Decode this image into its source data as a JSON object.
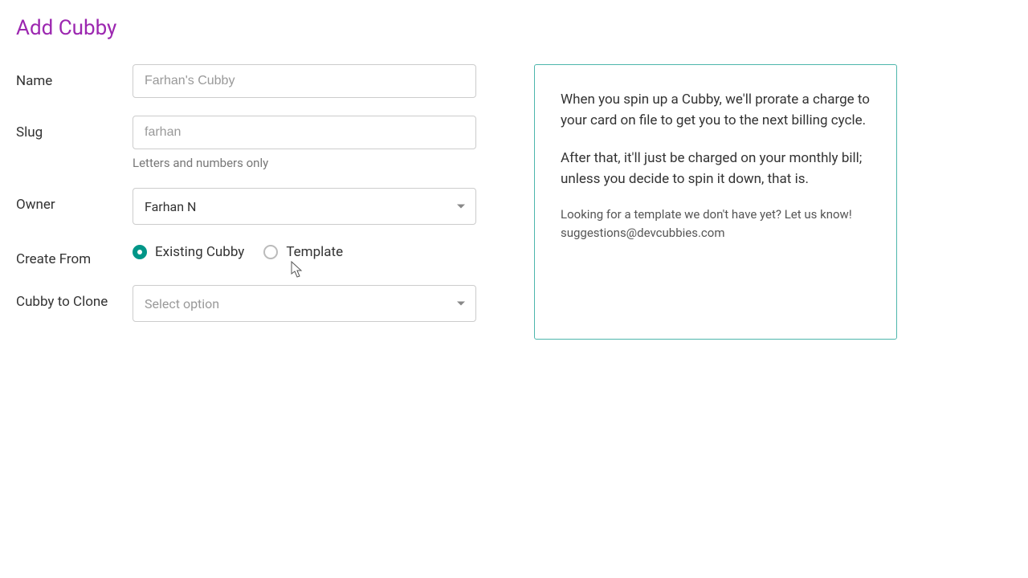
{
  "title": "Add Cubby",
  "form": {
    "name": {
      "label": "Name",
      "placeholder": "Farhan's Cubby",
      "value": ""
    },
    "slug": {
      "label": "Slug",
      "placeholder": "farhan",
      "value": "",
      "help": "Letters and numbers only"
    },
    "owner": {
      "label": "Owner",
      "selected": "Farhan N"
    },
    "createFrom": {
      "label": "Create From",
      "options": {
        "existing": "Existing Cubby",
        "template": "Template"
      },
      "selected": "existing"
    },
    "cubbyToClone": {
      "label": "Cubby to Clone",
      "placeholder": "Select option"
    }
  },
  "info": {
    "p1": "When you spin up a Cubby, we'll prorate a charge to your card on file to get you to the next billing cycle.",
    "p2": "After that, it'll just be charged on your monthly bill; unless you decide to spin it down, that is.",
    "p3": "Looking for a template we don't have yet? Let us know! suggestions@devcubbies.com"
  }
}
